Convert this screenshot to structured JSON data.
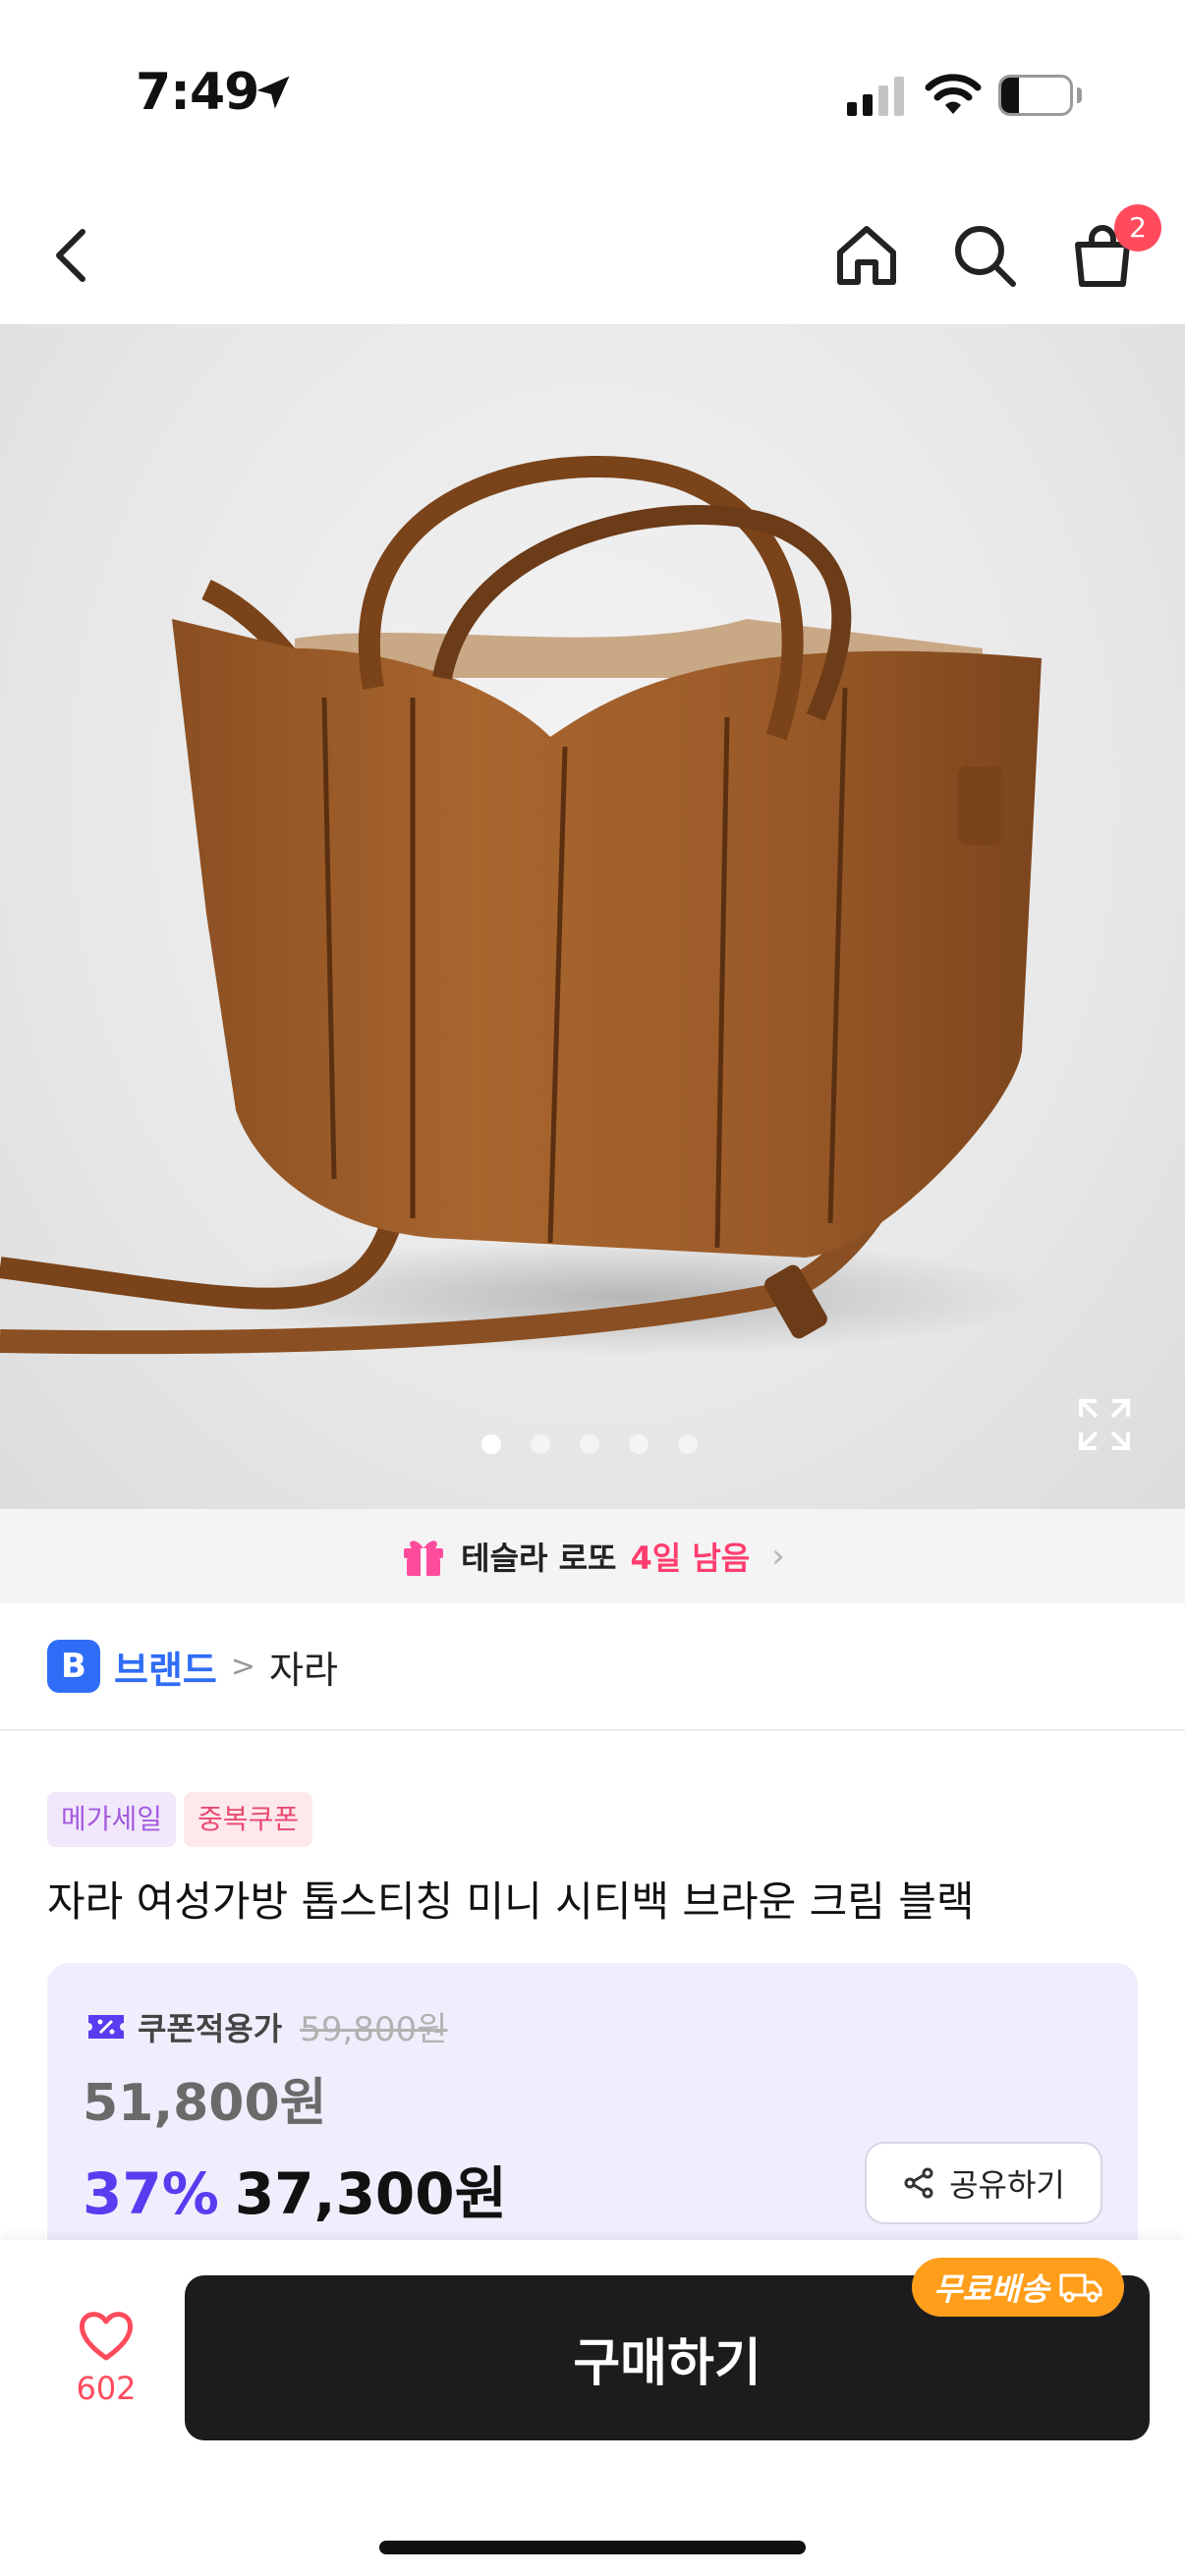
{
  "status_bar": {
    "time": "7:49",
    "battery_text": "25",
    "battery_level": 0.25
  },
  "nav": {
    "cart_count": "2"
  },
  "gallery": {
    "image_count": 5,
    "active_index": 0
  },
  "promo": {
    "event": "테슬라 로또",
    "days_left": "4일 남음",
    "chevron": "›"
  },
  "brand": {
    "badge": "B",
    "label": "브랜드",
    "separator": ">",
    "name": "자라"
  },
  "tags": [
    "메가세일",
    "중복쿠폰"
  ],
  "product": {
    "title": "자라 여성가방 톱스티칭 미니 시티백 브라운 크림 블랙"
  },
  "price": {
    "coupon_label": "쿠폰적용가",
    "original_price": "59,800원",
    "price": "51,800원",
    "discount": "37%",
    "final_price": "37,300원",
    "share_label": "공유하기"
  },
  "bottom": {
    "like_count": "602",
    "buy_label": "구매하기",
    "free_shipping": "무료배송"
  },
  "colors": {
    "accent": "#5a3cf0",
    "pink": "#ff3d6e",
    "brand_blue": "#2f6df6",
    "badge_red": "#ff4b5c",
    "shipping_orange": "#ff9e1b"
  },
  "icons": {
    "back": "chevron-left-icon",
    "home": "home-icon",
    "search": "search-icon",
    "cart": "shopping-bag-icon",
    "gift": "gift-icon",
    "share": "share-icon",
    "like": "heart-icon",
    "expand": "expand-icon",
    "coupon": "coupon-icon",
    "truck": "truck-icon"
  }
}
